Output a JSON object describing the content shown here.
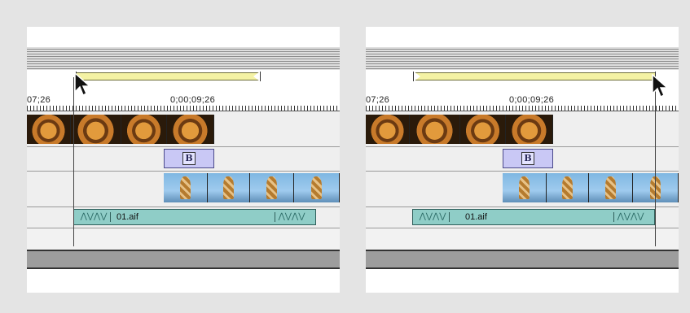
{
  "panels": [
    {
      "timecode_left": "07;26",
      "timecode_center": "0;00;09;26",
      "audio_clip_name": "01.aif",
      "transition_glyph": "B",
      "cursor": "arrow-cursor"
    },
    {
      "timecode_left": "07;26",
      "timecode_center": "0;00;09;26",
      "audio_clip_name": "01.aif",
      "transition_glyph": "B",
      "cursor": "arrow-cursor"
    }
  ],
  "colors": {
    "work_area": "#f4f2a4",
    "audio_clip": "#8fcdc7",
    "transition": "#c9c8f5"
  }
}
